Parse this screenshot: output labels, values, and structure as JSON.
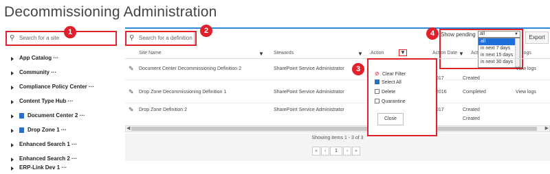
{
  "page_title": "Decommissioning Administration",
  "site_search": {
    "placeholder": "Search for a site"
  },
  "def_search": {
    "placeholder": "Search for a definition"
  },
  "badges": [
    "1",
    "2",
    "3",
    "4"
  ],
  "tree": [
    {
      "label": "App Catalog ···",
      "icon": false
    },
    {
      "label": "Community ···",
      "icon": false
    },
    {
      "label": "Compliance Policy Center ···",
      "icon": false
    },
    {
      "label": "Content Type Hub ···",
      "icon": false
    },
    {
      "label": "Document Center 2 ···",
      "icon": true
    },
    {
      "label": "Drop Zone 1 ···",
      "icon": true
    },
    {
      "label": "Enhanced Search 1 ···",
      "icon": false
    },
    {
      "label": "Enhanced Search 2 ···",
      "icon": false
    },
    {
      "label": "ERP-Link Dev 1 ···",
      "icon": false
    }
  ],
  "pending": {
    "label": "Show pending",
    "selected": "all",
    "options": [
      "all",
      "in next 7 days",
      "in next 15 days",
      "in next 30 days"
    ]
  },
  "export_label": "Export",
  "columns": {
    "site_name": "Site Name",
    "stewards": "Stewards",
    "action": "Action",
    "action_date": "Action Date",
    "action_status": "Act",
    "logs": "logs"
  },
  "rows": [
    {
      "site": "Document Center Decommissioning Definition 2",
      "steward": "SharePoint Service Administrator",
      "date": "017",
      "status": "Created",
      "logs": "View logs"
    },
    {
      "site": "Drop Zone Decommissioning Definition 1",
      "steward": "SharePoint Service Administrator",
      "date": "2016",
      "status": "Completed",
      "logs": "View logs"
    },
    {
      "site": "Drop Zone Definition 2",
      "steward": "SharePoint Service Administrator",
      "date": "017",
      "status": "Created",
      "logs": ""
    },
    {
      "site": "",
      "steward": "",
      "date": "",
      "status": "Created",
      "logs": ""
    }
  ],
  "showing_text": "Showing items 1 - 3 of 3",
  "pager": {
    "first": "«",
    "prev": "‹",
    "current": "1",
    "next": "›",
    "last": "»"
  },
  "filter_popup": {
    "clear_label": "Clear Filter",
    "select_all_label": "Select All",
    "options": [
      {
        "label": "Delete",
        "checked": false
      },
      {
        "label": "Quarantine",
        "checked": false
      }
    ],
    "close_label": "Close"
  }
}
